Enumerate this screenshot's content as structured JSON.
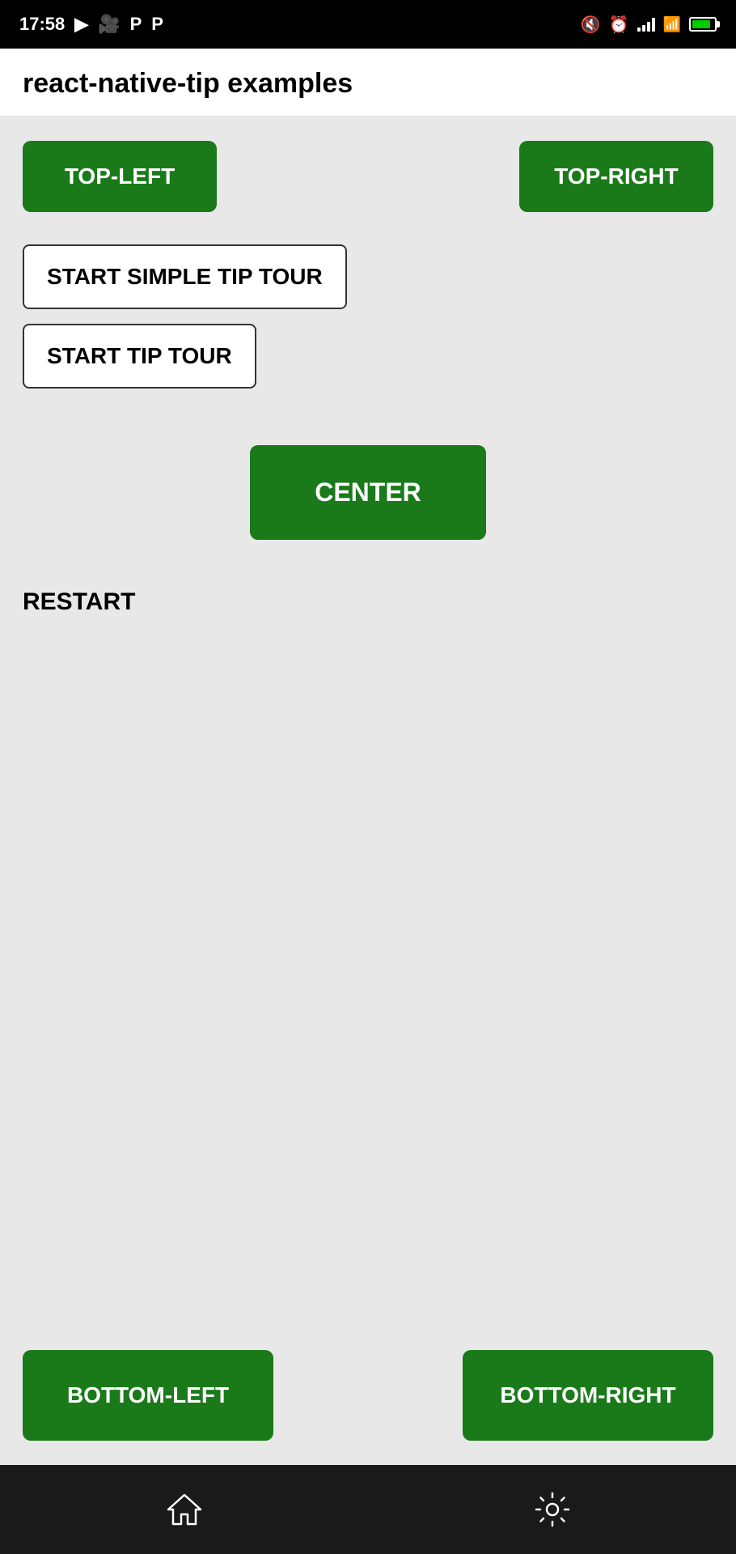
{
  "statusBar": {
    "time": "17:58",
    "icons": [
      "play-icon",
      "video-icon",
      "p-icon1",
      "p-icon2"
    ],
    "rightIcons": [
      "mute-icon",
      "alarm-icon",
      "signal-icon",
      "wifi-icon",
      "battery-icon"
    ]
  },
  "header": {
    "title": "react-native-tip examples"
  },
  "buttons": {
    "topLeft": "TOP-LEFT",
    "topRight": "TOP-RIGHT",
    "startSimpleTipTour": "START SIMPLE TIP TOUR",
    "startTipTour": "START TIP TOUR",
    "center": "CENTER",
    "restart": "RESTART",
    "bottomLeft": "BOTTOM-LEFT",
    "bottomRight": "BOTTOM-RIGHT"
  },
  "bottomNav": {
    "homeLabel": "home",
    "settingsLabel": "settings"
  }
}
